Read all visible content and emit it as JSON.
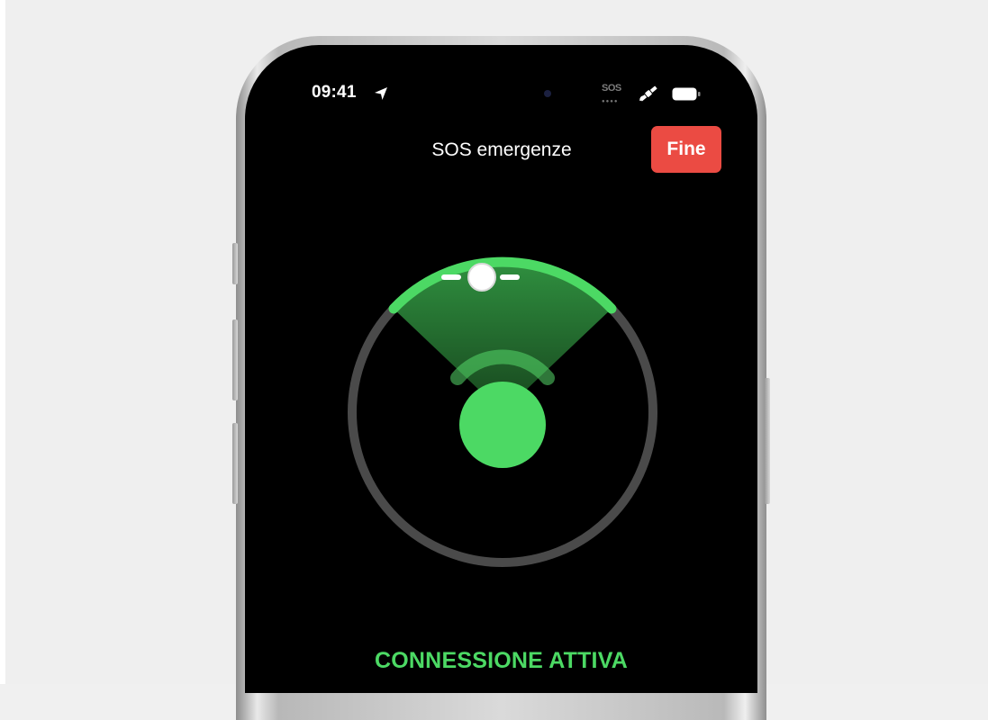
{
  "status_bar": {
    "time": "09:41",
    "carrier_text": "SOS",
    "location_icon": "location-arrow-icon",
    "satellite_icon": "satellite-icon",
    "battery_icon": "battery-icon"
  },
  "header": {
    "title": "SOS emergenze",
    "end_button_label": "Fine"
  },
  "compass": {
    "satellite_indicator_icon": "satellite-position-dot",
    "connection_strength": 1
  },
  "connection_status": "CONNESSIONE ATTIVA",
  "colors": {
    "accent_green": "#4cd964",
    "end_button_red": "#eb4b43",
    "ring_gray": "#4a4a4a",
    "screen_background": "#000000"
  }
}
